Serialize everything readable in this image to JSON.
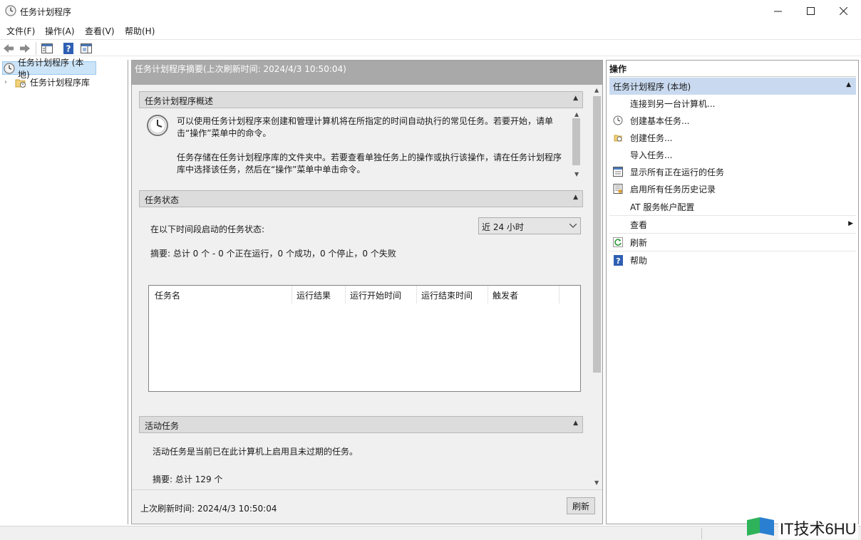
{
  "window": {
    "title": "任务计划程序"
  },
  "menu": [
    "文件(F)",
    "操作(A)",
    "查看(V)",
    "帮助(H)"
  ],
  "tree": {
    "root": "任务计划程序 (本地)",
    "child": "任务计划程序库"
  },
  "center": {
    "header": "任务计划程序摘要(上次刷新时间: 2024/4/3 10:50:04)",
    "overview": {
      "title": "任务计划程序概述",
      "para1": "可以使用任务计划程序来创建和管理计算机将在所指定的时间自动执行的常见任务。若要开始，请单击“操作”菜单中的命令。",
      "para2": "任务存储在任务计划程序库的文件夹中。若要查看单独任务上的操作或执行该操作，请在任务计划程序库中选择该任务，然后在“操作”菜单中单击命令。"
    },
    "status": {
      "title": "任务状态",
      "period_label": "在以下时间段启动的任务状态:",
      "period_value": "近 24 小时",
      "summary": "摘要: 总计 0 个 - 0 个正在运行，0 个成功，0 个停止，0 个失败",
      "columns": [
        "任务名",
        "运行结果",
        "运行开始时间",
        "运行结束时间",
        "触发者"
      ]
    },
    "active": {
      "title": "活动任务",
      "desc": "活动任务是当前已在此计算机上启用且未过期的任务。",
      "summary": "摘要: 总计 129 个"
    },
    "footer": {
      "last_refresh": "上次刷新时间: 2024/4/3 10:50:04",
      "refresh_button": "刷新"
    }
  },
  "actions": {
    "title": "操作",
    "group": "任务计划程序 (本地)",
    "items": [
      {
        "label": "连接到另一台计算机...",
        "icon": "none"
      },
      {
        "label": "创建基本任务...",
        "icon": "basic-task-icon"
      },
      {
        "label": "创建任务...",
        "icon": "create-task-icon"
      },
      {
        "label": "导入任务...",
        "icon": "none"
      },
      {
        "label": "显示所有正在运行的任务",
        "icon": "running-tasks-icon"
      },
      {
        "label": "启用所有任务历史记录",
        "icon": "history-icon"
      },
      {
        "label": "AT 服务帐户配置",
        "icon": "none"
      },
      {
        "label": "查看",
        "icon": "none"
      },
      {
        "label": "刷新",
        "icon": "refresh-icon"
      },
      {
        "label": "帮助",
        "icon": "help-icon"
      }
    ]
  },
  "watermark": {
    "text": "IT技术6HU"
  },
  "colors": {
    "selection": "#cce4f7",
    "group_header": "#c9daf0",
    "section_header": "#dcdcdc",
    "panel_bg": "#f0f0f0"
  }
}
